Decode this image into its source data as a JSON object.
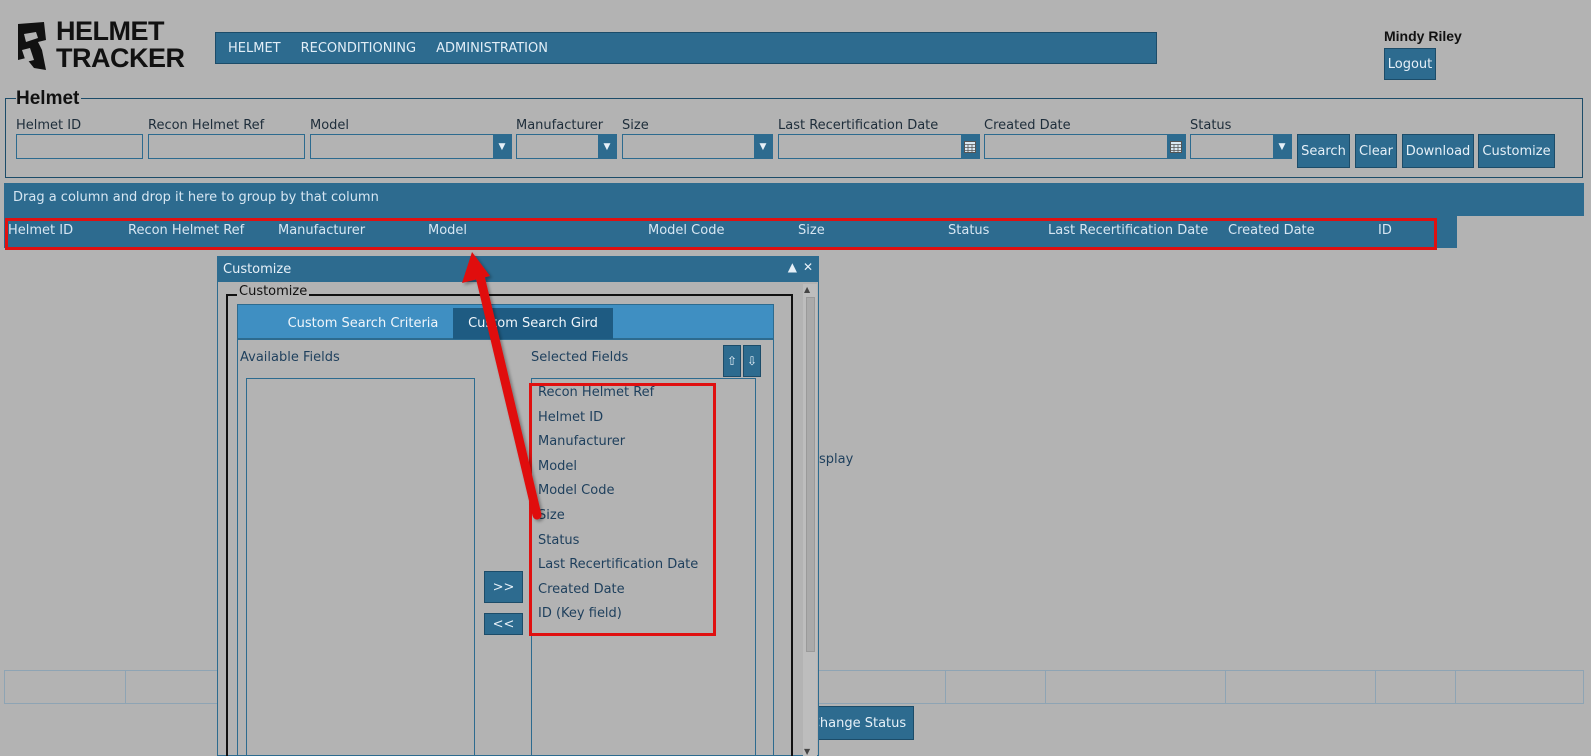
{
  "app": {
    "logo_line1": "HELMET",
    "logo_line2": "TRACKER"
  },
  "topnav": [
    {
      "label": "HELMET"
    },
    {
      "label": "RECONDITIONING"
    },
    {
      "label": "ADMINISTRATION"
    }
  ],
  "user": {
    "name": "Mindy Riley",
    "logout_label": "Logout"
  },
  "search": {
    "title": "Helmet",
    "fields": [
      {
        "label": "Helmet ID",
        "type": "text",
        "value": ""
      },
      {
        "label": "Recon Helmet Ref",
        "type": "text",
        "value": ""
      },
      {
        "label": "Model",
        "type": "dropdown",
        "value": ""
      },
      {
        "label": "Manufacturer",
        "type": "dropdown",
        "value": ""
      },
      {
        "label": "Size",
        "type": "dropdown",
        "value": ""
      },
      {
        "label": "Last Recertification Date",
        "type": "date",
        "value": ""
      },
      {
        "label": "Created Date",
        "type": "date",
        "value": ""
      },
      {
        "label": "Status",
        "type": "dropdown",
        "value": ""
      }
    ],
    "buttons": {
      "search": "Search",
      "clear": "Clear",
      "download": "Download",
      "customize": "Customize"
    }
  },
  "grid": {
    "group_hint": "Drag a column and drop it here to group by that column",
    "columns": [
      "Helmet ID",
      "Recon Helmet Ref",
      "Manufacturer",
      "Model",
      "Model Code",
      "Size",
      "Status",
      "Last Recertification Date",
      "Created Date",
      "ID"
    ],
    "empty_text_fragment": "splay",
    "change_status_label": "Change Status"
  },
  "dialog": {
    "title": "Customize",
    "fieldset_legend": "Customize",
    "tabs": [
      {
        "label": "Custom Search Criteria",
        "active": false
      },
      {
        "label": "Custom Search Gird",
        "active": true
      }
    ],
    "available_label": "Available Fields",
    "selected_label": "Selected Fields",
    "available_fields": [],
    "selected_fields": [
      "Recon Helmet Ref",
      "Helmet ID",
      "Manufacturer",
      "Model",
      "Model Code",
      "Size",
      "Status",
      "Last Recertification Date",
      "Created Date",
      "ID (Key field)"
    ],
    "move_right_label": ">>",
    "move_left_label": "<<",
    "move_up_label": "⇧",
    "move_down_label": "⇩"
  },
  "colors": {
    "background": "#b3b3b3",
    "primary": "#2d6b8f",
    "tab_bar": "#3f8fc2",
    "annotation": "#e01010"
  }
}
